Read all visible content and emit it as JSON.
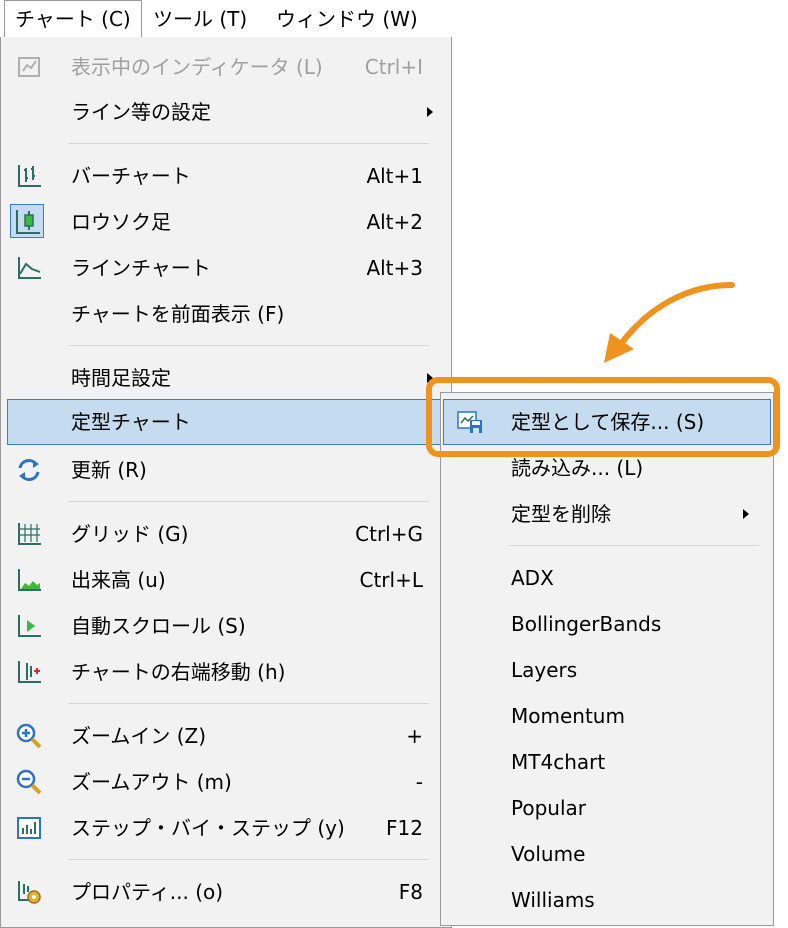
{
  "menubar": {
    "items": [
      {
        "label": "チャート (C)",
        "active": true
      },
      {
        "label": "ツール (T)",
        "active": false
      },
      {
        "label": "ウィンドウ (W)",
        "active": false
      }
    ]
  },
  "chart_menu": {
    "items": [
      {
        "label": "表示中のインディケータ (L)",
        "shortcut": "Ctrl+I",
        "disabled": true,
        "icon": "indicators-list-icon"
      },
      {
        "label": "ライン等の設定",
        "submenu": true
      },
      {
        "label": "バーチャート",
        "shortcut": "Alt+1",
        "icon": "bar-chart-icon"
      },
      {
        "label": "ロウソク足",
        "shortcut": "Alt+2",
        "icon": "candlestick-icon",
        "checked": true
      },
      {
        "label": "ラインチャート",
        "shortcut": "Alt+3",
        "icon": "line-chart-icon"
      },
      {
        "label": "チャートを前面表示 (F)"
      },
      {
        "label": "時間足設定",
        "submenu": true
      },
      {
        "label": "定型チャート",
        "submenu": true,
        "highlighted": true
      },
      {
        "label": "更新 (R)",
        "icon": "refresh-icon"
      },
      {
        "label": "グリッド (G)",
        "shortcut": "Ctrl+G",
        "icon": "grid-icon"
      },
      {
        "label": "出来高 (u)",
        "shortcut": "Ctrl+L",
        "icon": "volume-icon"
      },
      {
        "label": "自動スクロール (S)",
        "icon": "auto-scroll-icon"
      },
      {
        "label": "チャートの右端移動 (h)",
        "icon": "chart-shift-icon"
      },
      {
        "label": "ズームイン (Z)",
        "shortcut": "+",
        "icon": "zoom-in-icon"
      },
      {
        "label": "ズームアウト (m)",
        "shortcut": "-",
        "icon": "zoom-out-icon"
      },
      {
        "label": "ステップ・バイ・ステップ (y)",
        "shortcut": "F12",
        "icon": "step-by-step-icon"
      },
      {
        "label": "プロパティ... (o)",
        "shortcut": "F8",
        "icon": "properties-icon"
      }
    ]
  },
  "template_submenu": {
    "items": [
      {
        "label": "定型として保存... (S)",
        "icon": "save-template-icon",
        "highlighted": true
      },
      {
        "label": "読み込み... (L)"
      },
      {
        "label": "定型を削除",
        "submenu": true
      },
      {
        "label": "ADX"
      },
      {
        "label": "BollingerBands"
      },
      {
        "label": "Layers"
      },
      {
        "label": "Momentum"
      },
      {
        "label": "MT4chart"
      },
      {
        "label": "Popular"
      },
      {
        "label": "Volume"
      },
      {
        "label": "Williams"
      }
    ]
  },
  "colors": {
    "highlight_bg": "#c5dcf0",
    "highlight_border": "#3d7bd0",
    "callout": "#f0931e",
    "menu_bg": "#f2f2f2"
  }
}
